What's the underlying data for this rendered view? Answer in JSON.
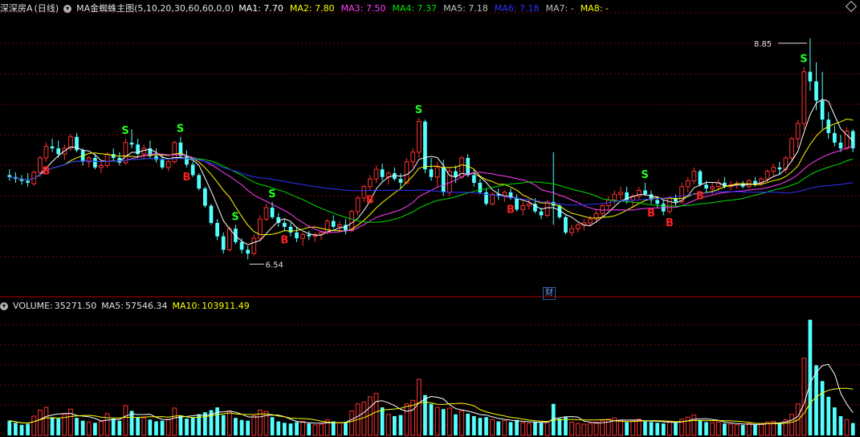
{
  "header": {
    "stock_name": "深深房A",
    "period": "(日线)",
    "indicator": "MA金蜘蛛主图(5,10,20,30,60,60,0,0)",
    "ma_values": [
      {
        "label": "MA1:",
        "value": "7.70",
        "color": "#ffffff"
      },
      {
        "label": "MA2:",
        "value": "7.80",
        "color": "#ffff00"
      },
      {
        "label": "MA3:",
        "value": "7.50",
        "color": "#ff40ff"
      },
      {
        "label": "MA4:",
        "value": "7.37",
        "color": "#00e000"
      },
      {
        "label": "MA5:",
        "value": "7.18",
        "color": "#c0c0c0"
      },
      {
        "label": "MA6:",
        "value": "7.18",
        "color": "#3030ff"
      },
      {
        "label": "MA7:",
        "value": "-",
        "color": "#c0c0c0"
      },
      {
        "label": "MA8:",
        "value": "-",
        "color": "#ffff00"
      }
    ]
  },
  "volume_header": {
    "label": "VOLUME:",
    "value": "35271.50",
    "ma5_label": "MA5:",
    "ma5_value": "57546.34",
    "ma10_label": "MA10:",
    "ma10_value": "103911.49"
  },
  "annotations": {
    "high_label": "8.85",
    "low_label": "6.54",
    "cai_badge": "财"
  },
  "colors": {
    "up": "#ff3232",
    "down": "#54ffff",
    "grid": "#800000",
    "signal_b": "#ff2020",
    "signal_s": "#20ff20"
  },
  "chart_data": {
    "type": "candlestick",
    "price_range": [
      6.3,
      9.1
    ],
    "volume_max": 350000,
    "high": 8.85,
    "low": 6.54,
    "ohlc": [
      [
        7.42,
        7.48,
        7.36,
        7.4
      ],
      [
        7.4,
        7.45,
        7.34,
        7.38
      ],
      [
        7.38,
        7.42,
        7.32,
        7.36
      ],
      [
        7.36,
        7.44,
        7.3,
        7.34
      ],
      [
        7.33,
        7.47,
        7.31,
        7.45
      ],
      [
        7.45,
        7.62,
        7.4,
        7.6
      ],
      [
        7.6,
        7.76,
        7.56,
        7.72
      ],
      [
        7.72,
        7.8,
        7.66,
        7.7
      ],
      [
        7.7,
        7.78,
        7.6,
        7.64
      ],
      [
        7.64,
        7.74,
        7.58,
        7.7
      ],
      [
        7.7,
        7.85,
        7.68,
        7.82
      ],
      [
        7.82,
        7.86,
        7.66,
        7.68
      ],
      [
        7.68,
        7.7,
        7.52,
        7.56
      ],
      [
        7.56,
        7.62,
        7.5,
        7.6
      ],
      [
        7.6,
        7.64,
        7.48,
        7.5
      ],
      [
        7.5,
        7.56,
        7.44,
        7.52
      ],
      [
        7.52,
        7.66,
        7.5,
        7.64
      ],
      [
        7.64,
        7.7,
        7.56,
        7.6
      ],
      [
        7.6,
        7.66,
        7.52,
        7.55
      ],
      [
        7.55,
        7.8,
        7.53,
        7.76
      ],
      [
        7.76,
        7.9,
        7.7,
        7.74
      ],
      [
        7.74,
        7.8,
        7.6,
        7.64
      ],
      [
        7.64,
        7.74,
        7.58,
        7.7
      ],
      [
        7.7,
        7.78,
        7.6,
        7.62
      ],
      [
        7.62,
        7.7,
        7.55,
        7.58
      ],
      [
        7.58,
        7.64,
        7.48,
        7.5
      ],
      [
        7.5,
        7.6,
        7.46,
        7.56
      ],
      [
        7.56,
        7.78,
        7.54,
        7.76
      ],
      [
        7.76,
        7.82,
        7.6,
        7.62
      ],
      [
        7.62,
        7.68,
        7.5,
        7.53
      ],
      [
        7.53,
        7.56,
        7.4,
        7.42
      ],
      [
        7.42,
        7.44,
        7.26,
        7.28
      ],
      [
        7.28,
        7.3,
        7.08,
        7.1
      ],
      [
        7.1,
        7.12,
        6.9,
        6.92
      ],
      [
        6.92,
        6.96,
        6.74,
        6.78
      ],
      [
        6.78,
        6.82,
        6.6,
        6.64
      ],
      [
        6.64,
        6.88,
        6.62,
        6.86
      ],
      [
        6.86,
        6.9,
        6.7,
        6.72
      ],
      [
        6.72,
        6.76,
        6.6,
        6.64
      ],
      [
        6.64,
        6.68,
        6.54,
        6.6
      ],
      [
        6.6,
        6.8,
        6.58,
        6.76
      ],
      [
        6.76,
        7.0,
        6.74,
        6.96
      ],
      [
        6.96,
        7.12,
        6.94,
        7.08
      ],
      [
        7.08,
        7.14,
        6.96,
        6.98
      ],
      [
        6.98,
        7.02,
        6.88,
        6.92
      ],
      [
        6.92,
        6.96,
        6.84,
        6.88
      ],
      [
        6.88,
        6.92,
        6.78,
        6.82
      ],
      [
        6.82,
        6.88,
        6.72,
        6.76
      ],
      [
        6.76,
        6.82,
        6.68,
        6.8
      ],
      [
        6.8,
        6.84,
        6.74,
        6.78
      ],
      [
        6.78,
        6.82,
        6.72,
        6.8
      ],
      [
        6.8,
        6.84,
        6.74,
        6.82
      ],
      [
        6.82,
        6.96,
        6.8,
        6.94
      ],
      [
        6.94,
        7.0,
        6.86,
        6.88
      ],
      [
        6.88,
        6.94,
        6.82,
        6.9
      ],
      [
        6.9,
        6.96,
        6.8,
        6.84
      ],
      [
        6.84,
        7.06,
        6.82,
        7.04
      ],
      [
        7.04,
        7.2,
        7.0,
        7.18
      ],
      [
        7.18,
        7.32,
        7.14,
        7.3
      ],
      [
        7.3,
        7.42,
        7.26,
        7.38
      ],
      [
        7.38,
        7.52,
        7.34,
        7.48
      ],
      [
        7.48,
        7.54,
        7.36,
        7.4
      ],
      [
        7.4,
        7.46,
        7.32,
        7.44
      ],
      [
        7.44,
        7.5,
        7.36,
        7.38
      ],
      [
        7.38,
        7.44,
        7.28,
        7.34
      ],
      [
        7.34,
        7.6,
        7.32,
        7.56
      ],
      [
        7.56,
        7.7,
        7.5,
        7.66
      ],
      [
        7.66,
        8.02,
        7.6,
        7.98
      ],
      [
        7.98,
        8.0,
        7.44,
        7.48
      ],
      [
        7.48,
        7.6,
        7.36,
        7.4
      ],
      [
        7.4,
        7.56,
        7.3,
        7.5
      ],
      [
        7.5,
        7.58,
        7.2,
        7.24
      ],
      [
        7.24,
        7.5,
        7.2,
        7.46
      ],
      [
        7.46,
        7.52,
        7.34,
        7.4
      ],
      [
        7.4,
        7.62,
        7.38,
        7.6
      ],
      [
        7.6,
        7.64,
        7.4,
        7.42
      ],
      [
        7.42,
        7.48,
        7.3,
        7.34
      ],
      [
        7.34,
        7.38,
        7.22,
        7.24
      ],
      [
        7.24,
        7.28,
        7.1,
        7.12
      ],
      [
        7.12,
        7.24,
        7.1,
        7.22
      ],
      [
        7.22,
        7.28,
        7.16,
        7.2
      ],
      [
        7.2,
        7.26,
        7.14,
        7.24
      ],
      [
        7.24,
        7.28,
        7.16,
        7.18
      ],
      [
        7.18,
        7.22,
        7.04,
        7.06
      ],
      [
        7.06,
        7.14,
        7.0,
        7.1
      ],
      [
        7.1,
        7.16,
        7.06,
        7.12
      ],
      [
        7.12,
        7.18,
        7.02,
        7.04
      ],
      [
        7.04,
        7.08,
        6.96,
        7.0
      ],
      [
        7.0,
        7.16,
        6.98,
        7.14
      ],
      [
        7.14,
        7.66,
        6.9,
        7.1
      ],
      [
        7.1,
        7.12,
        6.96,
        6.98
      ],
      [
        6.98,
        7.0,
        6.8,
        6.82
      ],
      [
        6.82,
        6.9,
        6.78,
        6.86
      ],
      [
        6.86,
        6.92,
        6.82,
        6.9
      ],
      [
        6.9,
        6.96,
        6.84,
        6.92
      ],
      [
        6.92,
        7.0,
        6.88,
        6.96
      ],
      [
        6.96,
        7.06,
        6.92,
        7.02
      ],
      [
        7.02,
        7.12,
        6.98,
        7.1
      ],
      [
        7.1,
        7.2,
        7.06,
        7.16
      ],
      [
        7.16,
        7.26,
        7.12,
        7.22
      ],
      [
        7.22,
        7.3,
        7.16,
        7.24
      ],
      [
        7.24,
        7.3,
        7.12,
        7.16
      ],
      [
        7.16,
        7.22,
        7.08,
        7.2
      ],
      [
        7.2,
        7.3,
        7.16,
        7.26
      ],
      [
        7.26,
        7.34,
        7.2,
        7.22
      ],
      [
        7.22,
        7.26,
        7.12,
        7.16
      ],
      [
        7.16,
        7.2,
        7.08,
        7.12
      ],
      [
        7.12,
        7.16,
        7.0,
        7.04
      ],
      [
        7.04,
        7.2,
        7.02,
        7.18
      ],
      [
        7.18,
        7.22,
        7.1,
        7.14
      ],
      [
        7.14,
        7.34,
        7.12,
        7.3
      ],
      [
        7.3,
        7.4,
        7.24,
        7.36
      ],
      [
        7.36,
        7.5,
        7.32,
        7.46
      ],
      [
        7.46,
        7.48,
        7.3,
        7.32
      ],
      [
        7.32,
        7.36,
        7.24,
        7.28
      ],
      [
        7.28,
        7.34,
        7.22,
        7.3
      ],
      [
        7.3,
        7.38,
        7.26,
        7.34
      ],
      [
        7.34,
        7.4,
        7.28,
        7.3
      ],
      [
        7.3,
        7.36,
        7.26,
        7.32
      ],
      [
        7.32,
        7.36,
        7.28,
        7.33
      ],
      [
        7.33,
        7.36,
        7.28,
        7.3
      ],
      [
        7.3,
        7.38,
        7.28,
        7.36
      ],
      [
        7.36,
        7.4,
        7.3,
        7.33
      ],
      [
        7.33,
        7.4,
        7.3,
        7.38
      ],
      [
        7.38,
        7.48,
        7.34,
        7.46
      ],
      [
        7.46,
        7.54,
        7.4,
        7.5
      ],
      [
        7.5,
        7.56,
        7.42,
        7.48
      ],
      [
        7.48,
        7.62,
        7.44,
        7.6
      ],
      [
        7.6,
        7.82,
        7.56,
        7.8
      ],
      [
        7.8,
        8.0,
        7.7,
        7.96
      ],
      [
        7.96,
        8.55,
        7.9,
        8.5
      ],
      [
        8.5,
        8.85,
        8.3,
        8.4
      ],
      [
        8.4,
        8.6,
        8.1,
        8.2
      ],
      [
        8.2,
        8.5,
        7.9,
        8.0
      ],
      [
        8.0,
        8.08,
        7.8,
        7.86
      ],
      [
        7.86,
        7.94,
        7.72,
        7.76
      ],
      [
        7.76,
        7.84,
        7.66,
        7.7
      ],
      [
        7.7,
        7.92,
        7.68,
        7.88
      ],
      [
        7.88,
        7.9,
        7.66,
        7.7
      ]
    ],
    "volume": [
      42000,
      36000,
      30000,
      33000,
      55000,
      72000,
      80000,
      52000,
      48000,
      60000,
      75000,
      50000,
      42000,
      38000,
      36000,
      40000,
      62000,
      48000,
      42000,
      85000,
      70000,
      52000,
      50000,
      45000,
      40000,
      42000,
      46000,
      78000,
      56000,
      48000,
      52000,
      60000,
      66000,
      72000,
      80000,
      58000,
      70000,
      50000,
      44000,
      42000,
      56000,
      72000,
      68000,
      52000,
      40000,
      36000,
      34000,
      38000,
      40000,
      34000,
      30000,
      32000,
      44000,
      40000,
      36000,
      36000,
      70000,
      90000,
      95000,
      110000,
      120000,
      80000,
      60000,
      55000,
      58000,
      90000,
      100000,
      160000,
      115000,
      90000,
      80000,
      75000,
      78000,
      60000,
      70000,
      62000,
      55000,
      50000,
      52000,
      45000,
      40000,
      42000,
      38000,
      44000,
      36000,
      34000,
      38000,
      36000,
      40000,
      90000,
      48000,
      52000,
      38000,
      34000,
      32000,
      34000,
      38000,
      42000,
      46000,
      50000,
      42000,
      38000,
      42000,
      46000,
      40000,
      38000,
      36000,
      34000,
      40000,
      36000,
      46000,
      52000,
      58000,
      44000,
      38000,
      36000,
      38000,
      34000,
      32000,
      30000,
      30000,
      34000,
      30000,
      34000,
      38000,
      40000,
      36000,
      44000,
      60000,
      90000,
      220000,
      330000,
      200000,
      155000,
      110000,
      80000,
      55000,
      45000,
      35271.5
    ],
    "ma_periods": [
      5,
      10,
      20,
      30,
      60
    ],
    "signals": [
      {
        "i": 6,
        "type": "B"
      },
      {
        "i": 19,
        "type": "S"
      },
      {
        "i": 28,
        "type": "S"
      },
      {
        "i": 29,
        "type": "B"
      },
      {
        "i": 37,
        "type": "S"
      },
      {
        "i": 43,
        "type": "S"
      },
      {
        "i": 45,
        "type": "B"
      },
      {
        "i": 59,
        "type": "B"
      },
      {
        "i": 67,
        "type": "S"
      },
      {
        "i": 82,
        "type": "B"
      },
      {
        "i": 104,
        "type": "S"
      },
      {
        "i": 105,
        "type": "B"
      },
      {
        "i": 108,
        "type": "B"
      },
      {
        "i": 113,
        "type": "B"
      },
      {
        "i": 130,
        "type": "S"
      }
    ]
  }
}
